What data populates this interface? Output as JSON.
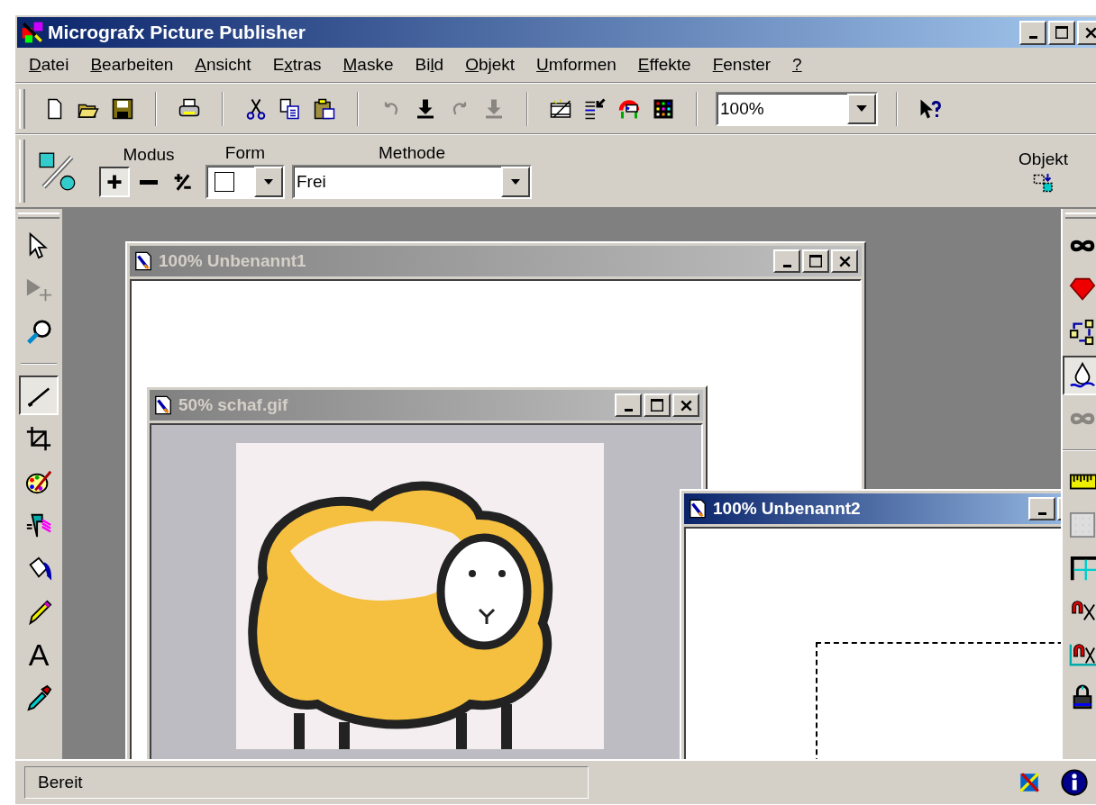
{
  "window": {
    "title": "Micrografx Picture Publisher"
  },
  "menu": [
    {
      "key": "D",
      "post": "atei"
    },
    {
      "key": "B",
      "post": "earbeiten"
    },
    {
      "key": "A",
      "post": "nsicht"
    },
    {
      "pre": "E",
      "key": "x",
      "post": "tras"
    },
    {
      "key": "M",
      "post": "aske"
    },
    {
      "pre": "Bi",
      "key": "l",
      "post": "d"
    },
    {
      "key": "O",
      "post": "bjekt"
    },
    {
      "key": "U",
      "post": "mformen"
    },
    {
      "key": "E",
      "post": "ffekte"
    },
    {
      "key": "F",
      "post": "enster"
    },
    {
      "key": "?"
    }
  ],
  "toolbar": [
    {
      "kind": "new",
      "disabled": false
    },
    {
      "kind": "open",
      "disabled": false
    },
    {
      "kind": "save",
      "disabled": false
    },
    {
      "kind": "sep"
    },
    {
      "kind": "print",
      "disabled": false
    },
    {
      "kind": "sep"
    },
    {
      "kind": "cut",
      "disabled": false
    },
    {
      "kind": "copy",
      "disabled": false
    },
    {
      "kind": "paste",
      "disabled": false
    },
    {
      "kind": "sep"
    },
    {
      "kind": "undo",
      "disabled": true
    },
    {
      "kind": "apply",
      "disabled": false
    },
    {
      "kind": "redo",
      "disabled": true
    },
    {
      "kind": "apply",
      "disabled": true
    },
    {
      "kind": "sep"
    },
    {
      "kind": "film",
      "disabled": false
    },
    {
      "kind": "list",
      "disabled": false
    },
    {
      "kind": "color",
      "disabled": false
    },
    {
      "kind": "palette",
      "disabled": false
    },
    {
      "kind": "sep"
    },
    {
      "kind": "zoom",
      "value": "100%"
    },
    {
      "kind": "sep"
    },
    {
      "kind": "help",
      "disabled": false
    }
  ],
  "options": {
    "mode_label": "Modus",
    "modes": [
      {
        "kind": "add",
        "selected": true
      },
      {
        "kind": "subtract",
        "selected": false
      },
      {
        "kind": "toggle",
        "selected": false
      }
    ],
    "form_label": "Form",
    "method_label": "Methode",
    "method_value": "Frei",
    "object_label": "Objekt"
  },
  "tools_left": [
    {
      "kind": "pointer",
      "selected": false,
      "disabled": false
    },
    {
      "kind": "move",
      "selected": false,
      "disabled": true
    },
    {
      "kind": "magnifier",
      "selected": false,
      "disabled": false
    },
    {
      "kind": "sep"
    },
    {
      "kind": "line",
      "selected": true,
      "disabled": false
    },
    {
      "kind": "crop",
      "selected": false,
      "disabled": false
    },
    {
      "kind": "paint",
      "selected": false,
      "disabled": false
    },
    {
      "kind": "effect",
      "selected": false,
      "disabled": false
    },
    {
      "kind": "fill",
      "selected": false,
      "disabled": false
    },
    {
      "kind": "pencil",
      "selected": false,
      "disabled": false
    },
    {
      "kind": "text",
      "glyph": "A",
      "selected": false,
      "disabled": false
    },
    {
      "kind": "dropper",
      "selected": false,
      "disabled": false
    }
  ],
  "tools_right": [
    {
      "kind": "infinity",
      "selected": false,
      "disabled": false
    },
    {
      "kind": "gem",
      "selected": false,
      "disabled": false
    },
    {
      "kind": "transform",
      "selected": false,
      "disabled": false
    },
    {
      "kind": "drop",
      "selected": true,
      "disabled": false
    },
    {
      "kind": "infinity",
      "selected": false,
      "disabled": true
    },
    {
      "kind": "sep"
    },
    {
      "kind": "ruler",
      "selected": false,
      "disabled": false
    },
    {
      "kind": "grid",
      "selected": false,
      "disabled": false
    },
    {
      "kind": "guide",
      "selected": false,
      "disabled": false
    },
    {
      "kind": "magnet",
      "selected": false,
      "disabled": false
    },
    {
      "kind": "magnet2",
      "selected": false,
      "disabled": false
    },
    {
      "kind": "lock",
      "selected": false,
      "disabled": false
    }
  ],
  "documents": [
    {
      "title": "100% Unbenannt1",
      "active": false,
      "kind": "blank"
    },
    {
      "title": "50% schaf.gif",
      "active": false,
      "kind": "image"
    },
    {
      "title": "100% Unbenannt2",
      "active": true,
      "kind": "selection"
    }
  ],
  "status_bar": {
    "text": "Bereit"
  }
}
